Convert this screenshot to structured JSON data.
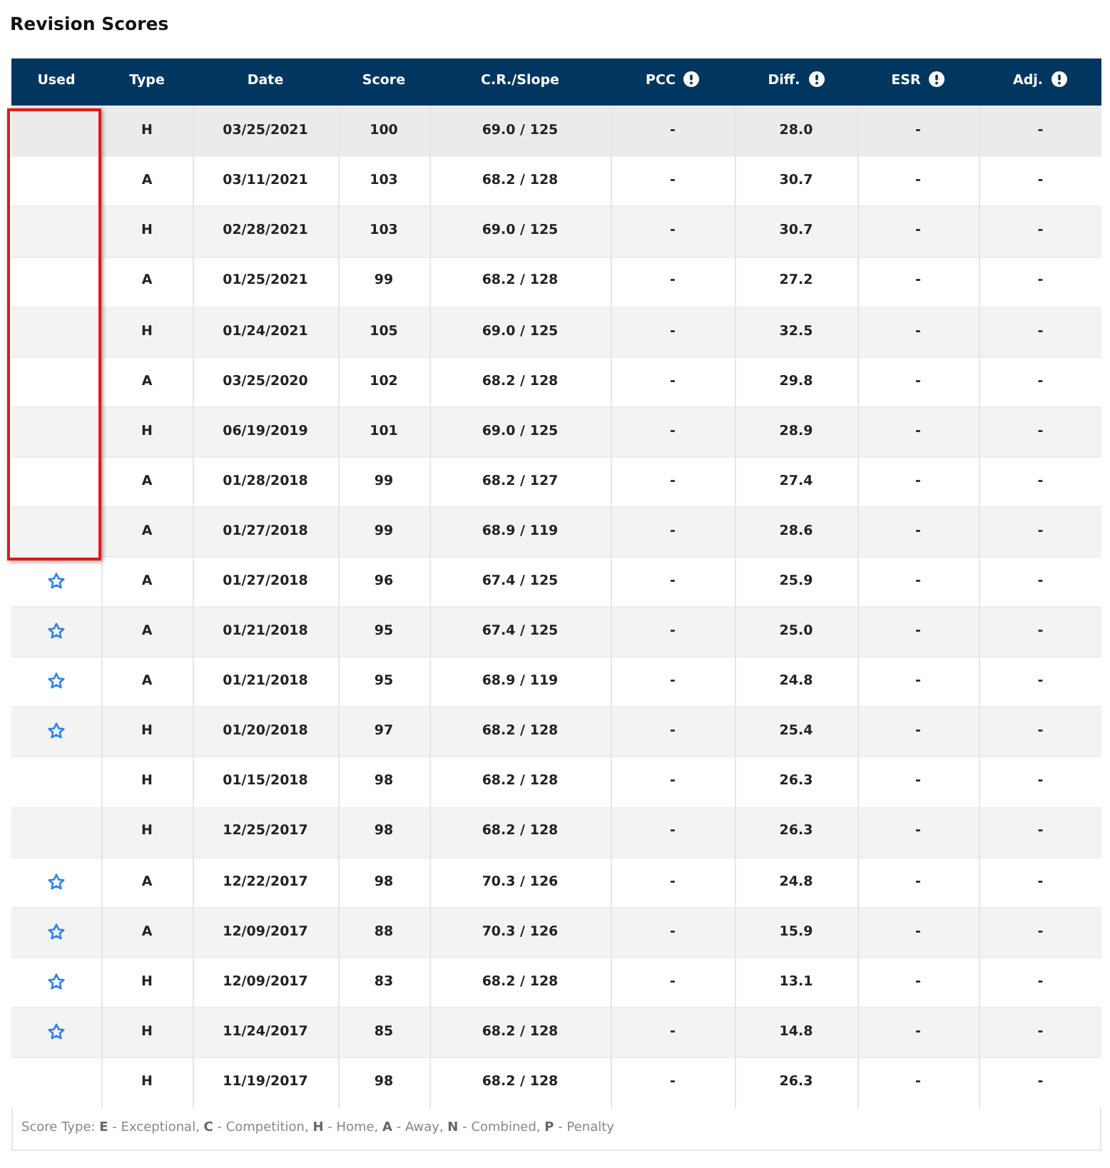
{
  "title": "Revision Scores",
  "columns": [
    {
      "label": "Used",
      "info": false
    },
    {
      "label": "Type",
      "info": false
    },
    {
      "label": "Date",
      "info": false
    },
    {
      "label": "Score",
      "info": false
    },
    {
      "label": "C.R./Slope",
      "info": false
    },
    {
      "label": "PCC",
      "info": true
    },
    {
      "label": "Diff.",
      "info": true
    },
    {
      "label": "ESR",
      "info": true
    },
    {
      "label": "Adj.",
      "info": true
    }
  ],
  "rows": [
    {
      "used": false,
      "highlighted": true,
      "type": "H",
      "date": "03/25/2021",
      "score": "100",
      "cr_slope": "69.0 / 125",
      "pcc": "-",
      "diff": "28.0",
      "esr": "-",
      "adj": "-"
    },
    {
      "used": false,
      "highlighted": true,
      "type": "A",
      "date": "03/11/2021",
      "score": "103",
      "cr_slope": "68.2 / 128",
      "pcc": "-",
      "diff": "30.7",
      "esr": "-",
      "adj": "-"
    },
    {
      "used": false,
      "highlighted": true,
      "type": "H",
      "date": "02/28/2021",
      "score": "103",
      "cr_slope": "69.0 / 125",
      "pcc": "-",
      "diff": "30.7",
      "esr": "-",
      "adj": "-"
    },
    {
      "used": false,
      "highlighted": true,
      "type": "A",
      "date": "01/25/2021",
      "score": "99",
      "cr_slope": "68.2 / 128",
      "pcc": "-",
      "diff": "27.2",
      "esr": "-",
      "adj": "-"
    },
    {
      "used": false,
      "highlighted": true,
      "type": "H",
      "date": "01/24/2021",
      "score": "105",
      "cr_slope": "69.0 / 125",
      "pcc": "-",
      "diff": "32.5",
      "esr": "-",
      "adj": "-"
    },
    {
      "used": false,
      "highlighted": true,
      "type": "A",
      "date": "03/25/2020",
      "score": "102",
      "cr_slope": "68.2 / 128",
      "pcc": "-",
      "diff": "29.8",
      "esr": "-",
      "adj": "-"
    },
    {
      "used": false,
      "highlighted": true,
      "type": "H",
      "date": "06/19/2019",
      "score": "101",
      "cr_slope": "69.0 / 125",
      "pcc": "-",
      "diff": "28.9",
      "esr": "-",
      "adj": "-"
    },
    {
      "used": false,
      "highlighted": true,
      "type": "A",
      "date": "01/28/2018",
      "score": "99",
      "cr_slope": "68.2 / 127",
      "pcc": "-",
      "diff": "27.4",
      "esr": "-",
      "adj": "-"
    },
    {
      "used": false,
      "highlighted": true,
      "type": "A",
      "date": "01/27/2018",
      "score": "99",
      "cr_slope": "68.9 / 119",
      "pcc": "-",
      "diff": "28.6",
      "esr": "-",
      "adj": "-"
    },
    {
      "used": true,
      "highlighted": false,
      "type": "A",
      "date": "01/27/2018",
      "score": "96",
      "cr_slope": "67.4 / 125",
      "pcc": "-",
      "diff": "25.9",
      "esr": "-",
      "adj": "-"
    },
    {
      "used": true,
      "highlighted": false,
      "type": "A",
      "date": "01/21/2018",
      "score": "95",
      "cr_slope": "67.4 / 125",
      "pcc": "-",
      "diff": "25.0",
      "esr": "-",
      "adj": "-"
    },
    {
      "used": true,
      "highlighted": false,
      "type": "A",
      "date": "01/21/2018",
      "score": "95",
      "cr_slope": "68.9 / 119",
      "pcc": "-",
      "diff": "24.8",
      "esr": "-",
      "adj": "-"
    },
    {
      "used": true,
      "highlighted": false,
      "type": "H",
      "date": "01/20/2018",
      "score": "97",
      "cr_slope": "68.2 / 128",
      "pcc": "-",
      "diff": "25.4",
      "esr": "-",
      "adj": "-"
    },
    {
      "used": false,
      "highlighted": false,
      "type": "H",
      "date": "01/15/2018",
      "score": "98",
      "cr_slope": "68.2 / 128",
      "pcc": "-",
      "diff": "26.3",
      "esr": "-",
      "adj": "-"
    },
    {
      "used": false,
      "highlighted": false,
      "type": "H",
      "date": "12/25/2017",
      "score": "98",
      "cr_slope": "68.2 / 128",
      "pcc": "-",
      "diff": "26.3",
      "esr": "-",
      "adj": "-"
    },
    {
      "used": true,
      "highlighted": false,
      "type": "A",
      "date": "12/22/2017",
      "score": "98",
      "cr_slope": "70.3 / 126",
      "pcc": "-",
      "diff": "24.8",
      "esr": "-",
      "adj": "-"
    },
    {
      "used": true,
      "highlighted": false,
      "type": "A",
      "date": "12/09/2017",
      "score": "88",
      "cr_slope": "70.3 / 126",
      "pcc": "-",
      "diff": "15.9",
      "esr": "-",
      "adj": "-"
    },
    {
      "used": true,
      "highlighted": false,
      "type": "H",
      "date": "12/09/2017",
      "score": "83",
      "cr_slope": "68.2 / 128",
      "pcc": "-",
      "diff": "13.1",
      "esr": "-",
      "adj": "-"
    },
    {
      "used": true,
      "highlighted": false,
      "type": "H",
      "date": "11/24/2017",
      "score": "85",
      "cr_slope": "68.2 / 128",
      "pcc": "-",
      "diff": "14.8",
      "esr": "-",
      "adj": "-"
    },
    {
      "used": false,
      "highlighted": false,
      "type": "H",
      "date": "11/19/2017",
      "score": "98",
      "cr_slope": "68.2 / 128",
      "pcc": "-",
      "diff": "26.3",
      "esr": "-",
      "adj": "-"
    }
  ],
  "legend": "Score Type: **E** - Exceptional, **C** - Competition, **H** - Home, **A** - Away, **N** - Combined, **P** - Penalty"
}
